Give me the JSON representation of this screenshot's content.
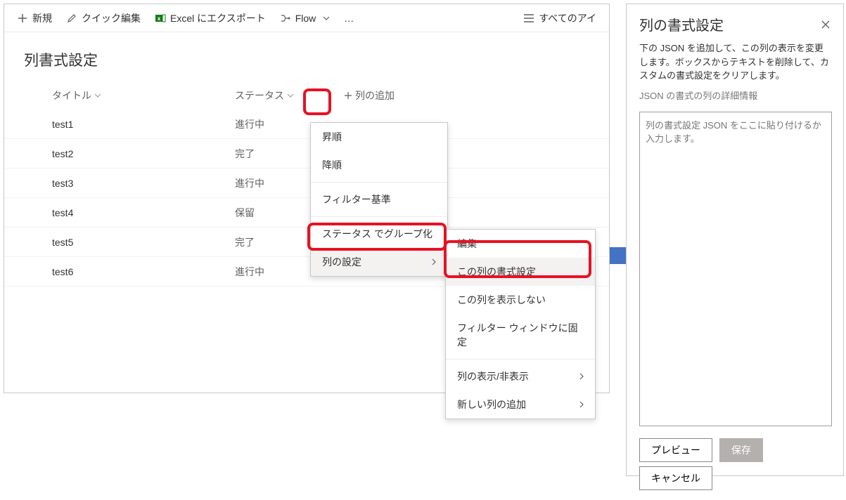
{
  "cmd": {
    "new_": "新規",
    "quick_edit": "クイック編集",
    "export_excel": "Excel にエクスポート",
    "flow": "Flow",
    "overflow": "…",
    "views": "すべてのアイ"
  },
  "page_title": "列書式設定",
  "headers": {
    "title": "タイトル",
    "status": "ステータス",
    "add": "列の追加"
  },
  "rows": [
    {
      "title": "test1",
      "status": "進行中"
    },
    {
      "title": "test2",
      "status": "完了"
    },
    {
      "title": "test3",
      "status": "進行中"
    },
    {
      "title": "test4",
      "status": "保留"
    },
    {
      "title": "test5",
      "status": "完了"
    },
    {
      "title": "test6",
      "status": "進行中"
    }
  ],
  "menu1": {
    "asc": "昇順",
    "desc": "降順",
    "filter": "フィルター基準",
    "group": "ステータス でグループ化",
    "colset": "列の設定"
  },
  "menu2": {
    "edit": "編集",
    "format": "この列の書式設定",
    "hide": "この列を表示しない",
    "pin": "フィルター ウィンドウに固定",
    "showhide": "列の表示/非表示",
    "addcol": "新しい列の追加"
  },
  "panel": {
    "title": "列の書式設定",
    "desc": "下の JSON を追加して、この列の表示を変更します。ボックスからテキストを削除して、カスタムの書式設定をクリアします。",
    "link": "JSON の書式の列の詳細情報",
    "placeholder": "列の書式設定 JSON をここに貼り付けるか入力します。",
    "preview": "プレビュー",
    "save": "保存",
    "cancel": "キャンセル"
  }
}
